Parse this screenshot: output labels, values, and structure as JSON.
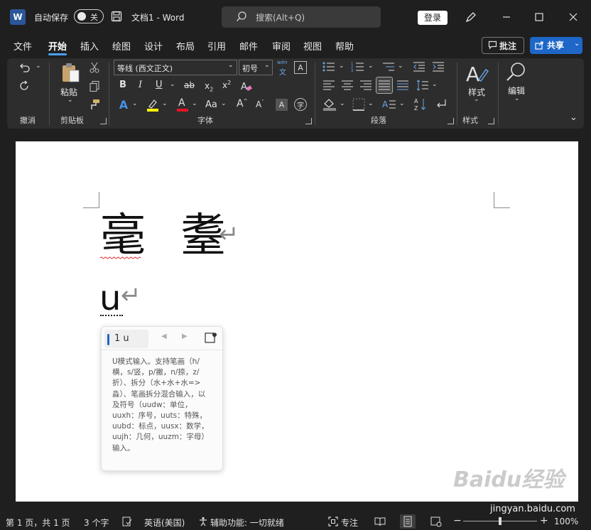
{
  "titlebar": {
    "app_logo": "W",
    "autosave_label": "自动保存",
    "autosave_state": "关",
    "doc_title": "文档1  -  Word",
    "search_placeholder": "搜索(Alt+Q)",
    "login_label": "登录",
    "icons": [
      "word-logo",
      "save-icon",
      "search-icon",
      "pen-icon",
      "minimize-icon",
      "maximize-icon",
      "close-icon"
    ]
  },
  "menu": {
    "tabs": [
      "文件",
      "开始",
      "插入",
      "绘图",
      "设计",
      "布局",
      "引用",
      "邮件",
      "审阅",
      "视图",
      "帮助"
    ],
    "active_tab": "开始",
    "comment_label": "批注",
    "share_label": "共享"
  },
  "ribbon": {
    "groups": [
      "撤消",
      "剪贴板",
      "字体",
      "段落",
      "样式"
    ],
    "paste_label": "粘贴",
    "font_name": "等线 (西文正文)",
    "font_size": "初号",
    "phonetic_guide": "wén",
    "styles_label": "样式",
    "editing_label": "编辑",
    "accent_colors": {
      "highlight": "#ffff00",
      "font_color": "#e81123",
      "accent": "#1e67c8"
    }
  },
  "document": {
    "line1_char1": "毫",
    "line1_char2": "耋",
    "para_mark": "↵",
    "line2_text": "u"
  },
  "ime": {
    "candidate": "1 u",
    "hint": "U模式输入。支持笔画（h/横，s/竖，p/撇，n/捺，z/折）、拆分（水+水+水=>淼）、笔画拆分混合输入，以及符号（uudw：单位，uuxh：序号，uuts：特殊，uubd：标点，uusx：数学，uujh：几何，uuzm：字母）输入。"
  },
  "watermark": {
    "logo_text": "Baidu经验",
    "url": "jingyan.baidu.com"
  },
  "statusbar": {
    "page_info": "第 1 页，共 1 页",
    "word_count": "3 个字",
    "language": "英语(美国)",
    "accessibility": "辅助功能: 一切就绪",
    "focus": "专注",
    "zoom": "100%"
  }
}
